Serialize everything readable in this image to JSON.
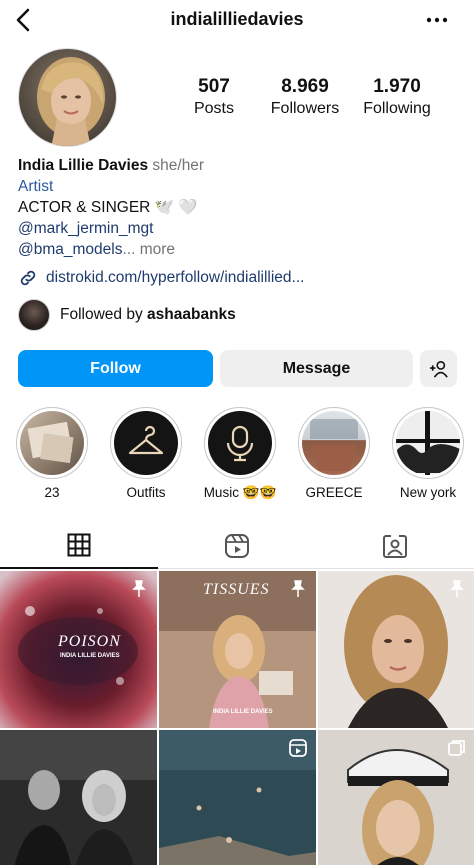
{
  "header": {
    "username": "indialilliedavies",
    "back_icon": "chevron-left-icon",
    "more_icon": "more-horizontal-icon"
  },
  "stats": {
    "posts": {
      "value": "507",
      "label": "Posts"
    },
    "followers": {
      "value": "8.969",
      "label": "Followers"
    },
    "following": {
      "value": "1.970",
      "label": "Following"
    }
  },
  "bio": {
    "name": "India Lillie Davies",
    "pronouns": "she/her",
    "category": "Artist",
    "line1": "ACTOR & SINGER 🕊️ 🤍",
    "mention1": "@mark_jermin_mgt",
    "mention2": "@bma_models",
    "more": "... more"
  },
  "link": {
    "icon": "link-icon",
    "text": "distrokid.com/hyperfollow/indialillied..."
  },
  "followed_by": {
    "prefix": "Followed by",
    "user": "ashaabanks"
  },
  "actions": {
    "follow": "Follow",
    "message": "Message",
    "add_user_icon": "add-person-icon"
  },
  "highlights": [
    {
      "label": "23"
    },
    {
      "label": "Outfits"
    },
    {
      "label": "Music 🤓🤓"
    },
    {
      "label": "GREECE"
    },
    {
      "label": "New york"
    }
  ],
  "tabs": [
    {
      "name": "grid-icon",
      "active": true
    },
    {
      "name": "reels-icon",
      "active": false
    },
    {
      "name": "tagged-icon",
      "active": false
    }
  ],
  "posts": [
    {
      "title": "POISON",
      "subtitle": "INDIA LILLIE DAVIES",
      "badge": "pin-icon"
    },
    {
      "title": "TISSUES",
      "subtitle": "INDIA LILLIE DAVIES",
      "badge": "pin-icon"
    },
    {
      "title": "",
      "subtitle": "",
      "badge": "pin-icon"
    },
    {
      "title": "",
      "subtitle": "",
      "badge": ""
    },
    {
      "title": "",
      "subtitle": "",
      "badge": "reel-icon"
    },
    {
      "title": "",
      "subtitle": "",
      "badge": "carousel-icon"
    }
  ],
  "colors": {
    "follow_button": "#0095f6",
    "message_button": "#efefef",
    "link_text": "#1f3b6d",
    "category_text": "#2c5aa0",
    "muted_text": "#737373"
  }
}
